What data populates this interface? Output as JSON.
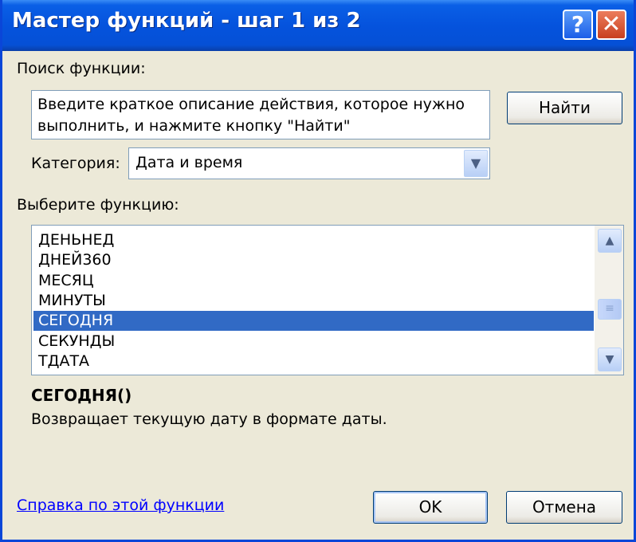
{
  "window": {
    "title": "Мастер функций - шаг 1 из 2",
    "help_button": "?",
    "close_button": "✕"
  },
  "search": {
    "label": "Поиск функции:",
    "text": "Введите краткое описание действия, которое нужно\nвыполнить, и нажмите кнопку \"Найти\"",
    "find_button": "Найти"
  },
  "category": {
    "label": "Категория:",
    "selected": "Дата и время"
  },
  "functions": {
    "label": "Выберите функцию:",
    "items": [
      "ДЕНЬНЕД",
      "ДНЕЙ360",
      "МЕСЯЦ",
      "МИНУТЫ",
      "СЕГОДНЯ",
      "СЕКУНДЫ",
      "ТДАТА"
    ],
    "selected_index": 4
  },
  "selected_function": {
    "signature": "СЕГОДНЯ()",
    "description": "Возвращает текущую дату в формате даты."
  },
  "footer": {
    "help_link": "Справка по этой функции",
    "ok_button": "OK",
    "cancel_button": "Отмена"
  },
  "colors": {
    "titlebar": "#0553dd",
    "selection": "#316ac5",
    "dialog_bg": "#ece9d8",
    "link": "#0000ff"
  },
  "icons": {
    "combo_arrow": "chevron-down-icon",
    "scroll_up": "chevron-up-icon",
    "scroll_down": "chevron-down-icon",
    "scroll_thumb": "grip-icon"
  }
}
